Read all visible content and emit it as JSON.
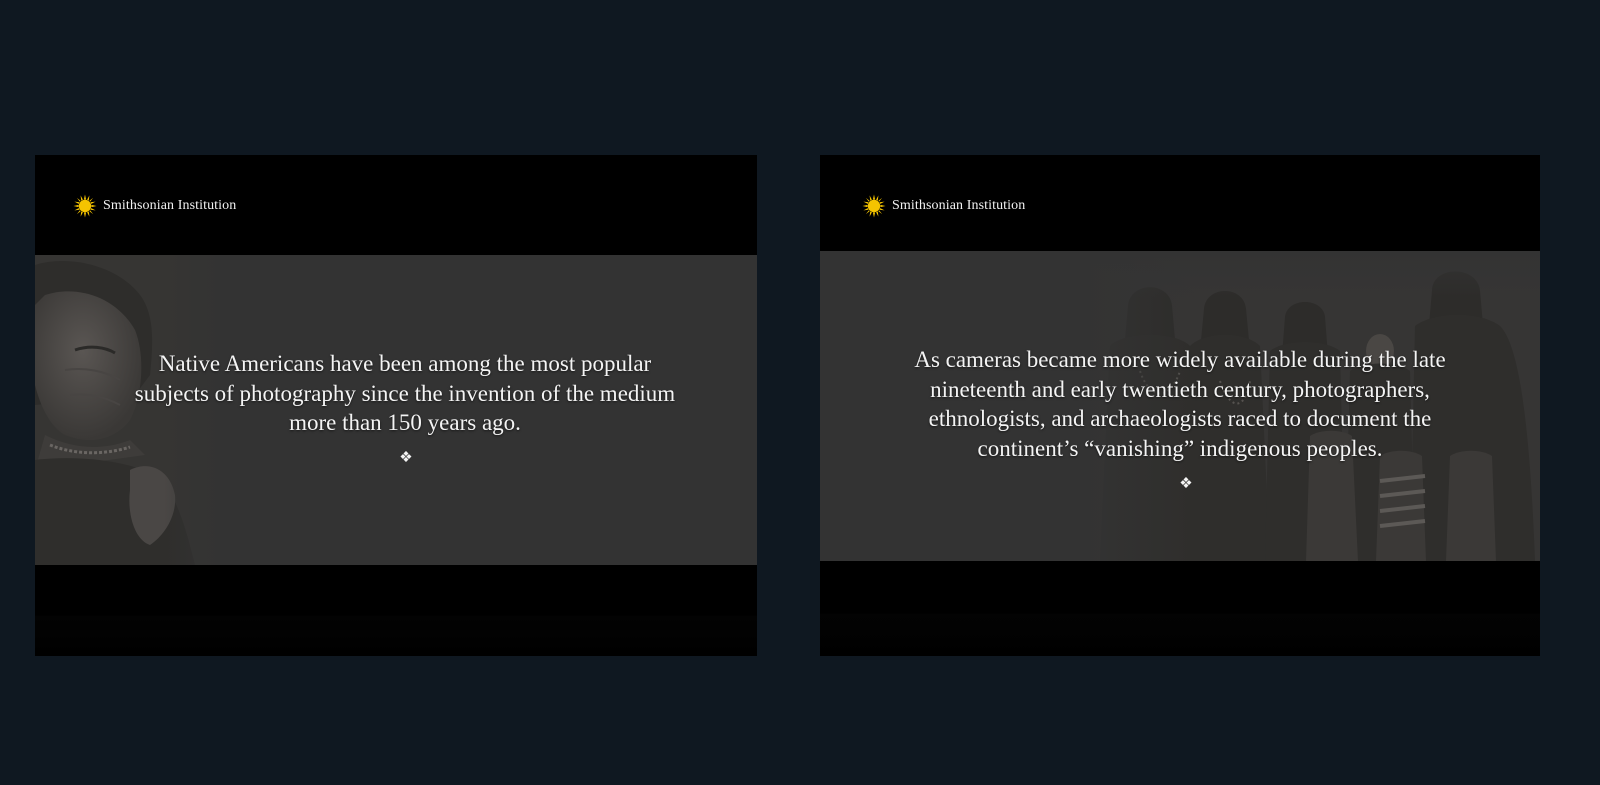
{
  "colors": {
    "page_background": "#0f1821",
    "slide_frame": "#000000",
    "slide_panel": "#333333",
    "sun_logo": "#f5c400",
    "text": "#f4f4f4"
  },
  "slides": [
    {
      "brand": {
        "icon": "smithsonian-sun-icon",
        "name": "Smithsonian Institution"
      },
      "quote": "Native Americans have been among the most popular subjects of photography since the invention of the medium more than 150 years ago.",
      "ornament": "❖",
      "photo": "portrait-photo"
    },
    {
      "brand": {
        "icon": "smithsonian-sun-icon",
        "name": "Smithsonian Institution"
      },
      "quote": "As cameras became more widely available during the late nineteenth and early twentieth century, photographers, ethnologists, and archaeologists  raced to document the continent’s “vanishing” indigenous peoples.",
      "ornament": "❖",
      "photo": "group-photo"
    }
  ]
}
